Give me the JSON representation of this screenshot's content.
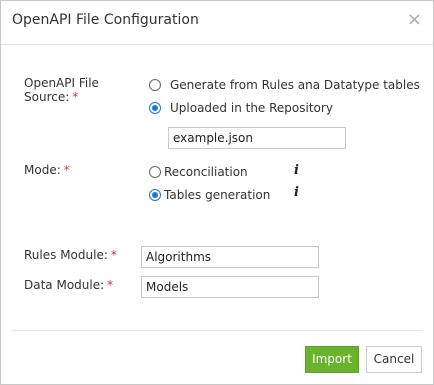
{
  "dialog": {
    "title": "OpenAPI File Configuration",
    "close_symbol": "×"
  },
  "source": {
    "label_line1": "OpenAPI File",
    "label_line2": "Source:",
    "required_mark": "*",
    "options": [
      {
        "label": "Generate from Rules ana Datatype tables",
        "checked": false
      },
      {
        "label": "Uploaded in the Repository",
        "checked": true
      }
    ],
    "file_value": "example.json"
  },
  "mode": {
    "label": "Mode:",
    "required_mark": "*",
    "options": [
      {
        "label": "Reconciliation",
        "checked": false,
        "info_icon": "info-icon"
      },
      {
        "label": "Tables generation",
        "checked": true,
        "info_icon": "info-icon"
      }
    ],
    "info_symbol": "i"
  },
  "rules_module": {
    "label": "Rules Module:",
    "required_mark": "*",
    "value": "Algorithms"
  },
  "data_module": {
    "label": "Data Module:",
    "required_mark": "*",
    "value": "Models"
  },
  "footer": {
    "import_label": "Import",
    "cancel_label": "Cancel"
  },
  "colors": {
    "accent": "#1a73e8",
    "primary_button": "#6ab42d",
    "required": "#d9302c"
  }
}
